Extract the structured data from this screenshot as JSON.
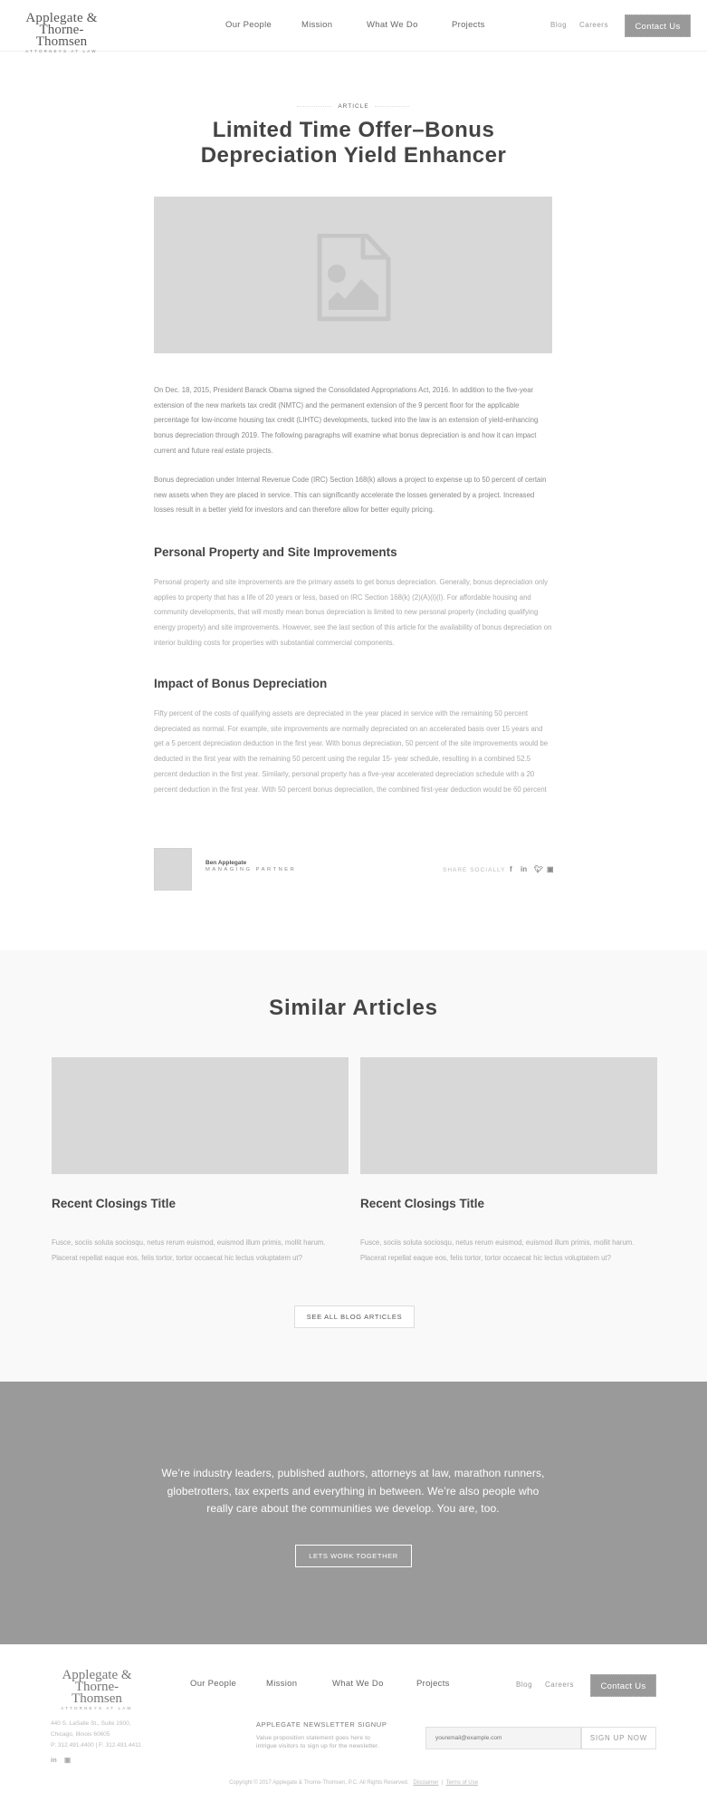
{
  "header": {
    "logo": {
      "line1": "Applegate &",
      "line2": "Thorne-Thomsen",
      "line3": "ATTORNEYS AT LAW"
    },
    "nav_main": [
      "Our People",
      "Mission",
      "What We Do",
      "Projects"
    ],
    "nav_secondary": [
      "Blog",
      "Careers"
    ],
    "contact_label": "Contact Us"
  },
  "article": {
    "kicker": "ARTICLE",
    "title_line1": "Limited Time Offer–Bonus",
    "title_line2": "Depreciation Yield Enhancer",
    "hero_icon": "image-file-icon",
    "paragraphs": [
      "On Dec. 18, 2015, President Barack Obama signed the Consolidated Appropriations Act, 2016. In addition to the five-year extension of the new markets tax credit (NMTC) and the permanent extension of the 9 percent floor for the applicable percentage for low-income housing tax credit (LIHTC) developments, tucked into the law is an extension of yield-enhancing bonus depreciation through 2019. The following paragraphs will examine what bonus depreciation is and how it can impact current and future real estate projects.",
      "Bonus depreciation under Internal Revenue Code (IRC) Section 168(k) allows a project to expense up to 50 percent of certain new assets when they are placed in service. This can significantly accelerate the losses generated by a project. Increased losses result in a better yield for investors and can therefore allow for better equity pricing."
    ],
    "sections": [
      {
        "heading": "Personal Property and Site Improvements",
        "body": "Personal property and site improvements are the primary assets to get bonus depreciation. Generally, bonus depreciation only applies to property that has a life of 20 years or less, based on IRC Section 168(k) (2)(A)(i)(I). For affordable housing and community developments, that will mostly mean bonus depreciation is limited to new personal property (including qualifying energy property) and site improvements. However, see the last section of this article for the availability of bonus depreciation on interior building costs for properties with substantial commercial components."
      },
      {
        "heading": "Impact of Bonus Depreciation",
        "body": "Fifty percent of the costs of qualifying assets are depreciated in the year placed in service with the remaining 50 percent depreciated as normal. For example, site improvements are normally depreciated on an accelerated basis over 15 years and get a 5 percent depreciation deduction in the first year. With bonus depreciation, 50 percent of the site improvements would be deducted in the first year with the remaining 50 percent using the regular 15- year schedule, resulting in a combined 52.5 percent deduction in the first year. Similarly, personal property has a five-year accelerated depreciation schedule with a 20 percent deduction in the first year. With 50 percent bonus depreciation, the combined first-year deduction would be 60 percent"
      }
    ],
    "author": {
      "name": "Ben Applegate",
      "role": "MANAGING PARTNER"
    },
    "share_label": "SHARE SOCIALLY",
    "share_icons": [
      "facebook-icon",
      "linkedin-icon",
      "twitter-icon",
      "instagram-icon"
    ]
  },
  "similar": {
    "title": "Similar Articles",
    "cards": [
      {
        "title": "Recent Closings Title",
        "text": "Fusce, sociis soluta sociosqu, netus rerum euismod, euismod illum primis, mollit harum. Placerat repellat eaque eos, felis tortor, tortor occaecat hic lectus voluptatem ut?"
      },
      {
        "title": "Recent Closings Title",
        "text": "Fusce, sociis soluta sociosqu, netus rerum euismod, euismod illum primis, mollit harum. Placerat repellat eaque eos, felis tortor, tortor occaecat hic lectus voluptatem ut?"
      }
    ],
    "see_all_label": "SEE ALL BLOG ARTICLES"
  },
  "cta": {
    "text": "We’re industry leaders, published authors, attorneys at law, marathon runners, globetrotters, tax experts and everything in between. We’re also people who really care about the communities we develop. You are, too.",
    "button_label": "LETS WORK TOGETHER"
  },
  "footer": {
    "logo": {
      "line1": "Applegate &",
      "line2": "Thorne-Thomsen",
      "line3": "ATTORNEYS AT LAW"
    },
    "nav_main": [
      "Our People",
      "Mission",
      "What We Do",
      "Projects"
    ],
    "nav_secondary": [
      "Blog",
      "Careers"
    ],
    "contact_label": "Contact Us",
    "address": [
      "440 S. LaSalle St., Suite 1900,",
      "Chicago, Illinois 60605",
      "P: 312.491.4400  |  F: 312.491.4411"
    ],
    "social_icons": [
      "linkedin-icon",
      "instagram-icon"
    ],
    "newsletter": {
      "title": "APPLEGATE NEWSLETTER SIGNUP",
      "description": "Value proposition statement goes here to intrigue visitors to sign up for the newsletter.",
      "placeholder": "youremail@example.com",
      "button_label": "SIGN UP NOW"
    },
    "copyright": "Copyright © 2017 Applegate & Thorne-Thomsen, P.C. All Rights Reserved.",
    "links": [
      "Disclaimer",
      "Terms of Use"
    ],
    "link_separator": "|"
  }
}
